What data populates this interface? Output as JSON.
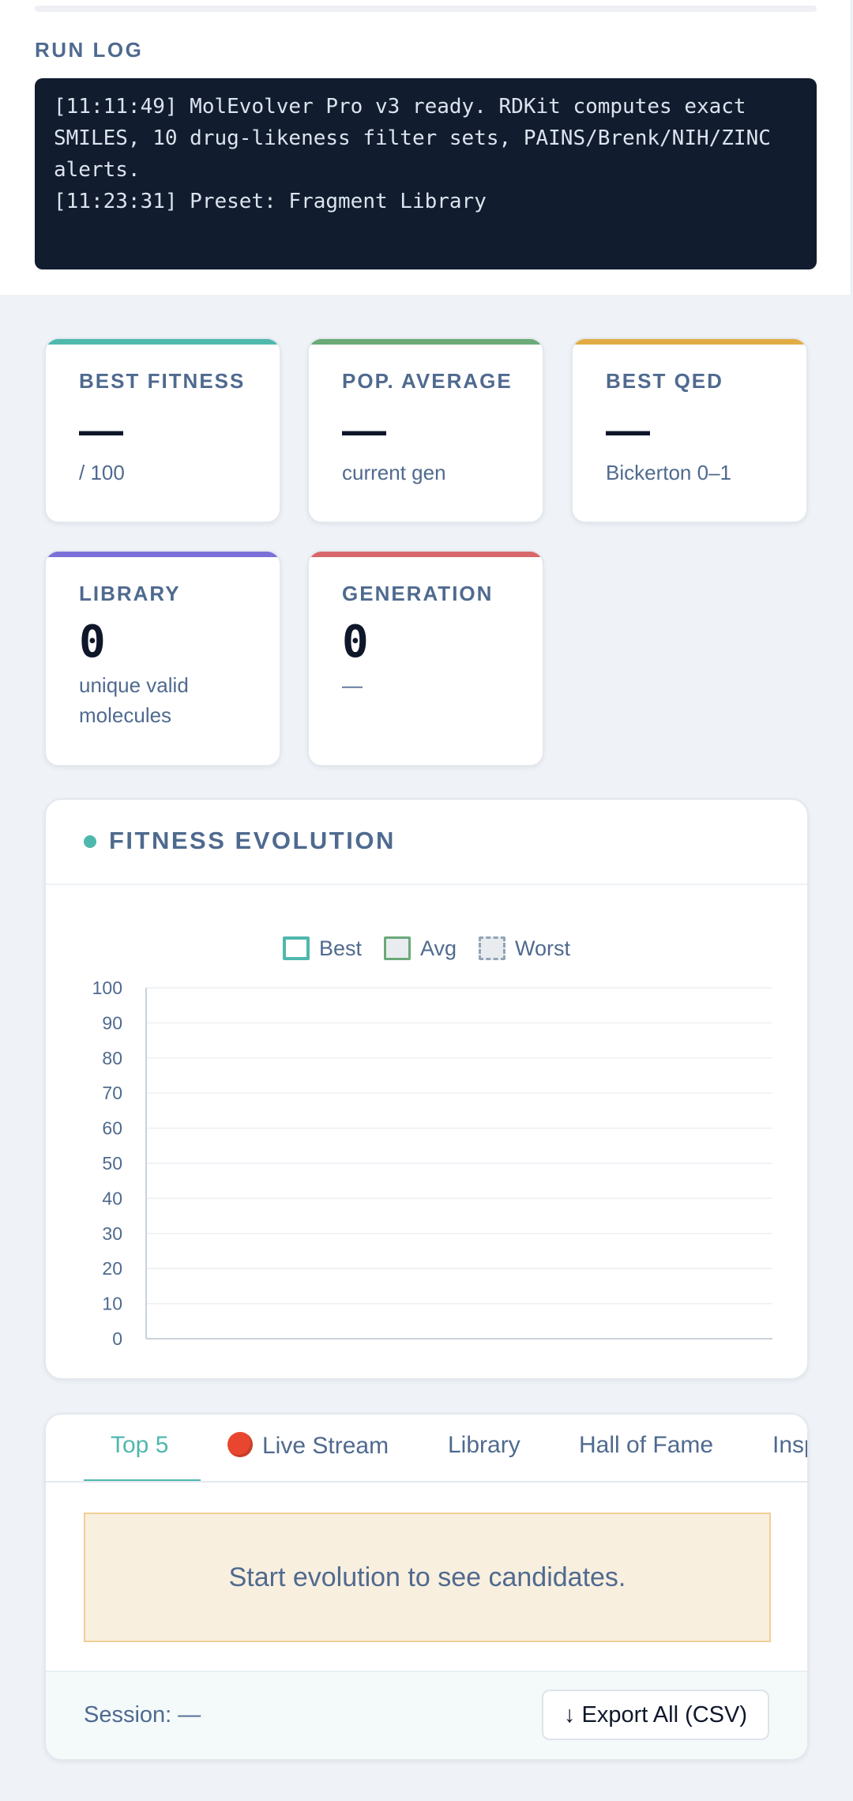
{
  "run_log": {
    "title": "RUN LOG",
    "lines": [
      "[11:11:49] MolEvolver Pro v3 ready. RDKit computes exact SMILES, 10 drug-likeness filter sets, PAINS/Brenk/NIH/ZINC alerts.",
      "[11:23:31] Preset: Fragment Library"
    ]
  },
  "stats": {
    "best_fitness": {
      "label": "BEST FITNESS",
      "value": "—",
      "sub": "/ 100",
      "accent": "#4fb8ad"
    },
    "pop_average": {
      "label": "POP. AVERAGE",
      "value": "—",
      "sub": "current gen",
      "accent": "#6aaa78"
    },
    "best_qed": {
      "label": "BEST QED",
      "value": "—",
      "sub": "Bickerton 0–1",
      "accent": "#e2ac45"
    },
    "library": {
      "label": "LIBRARY",
      "value": "0",
      "sub": "unique valid molecules",
      "accent": "#7b6fd8"
    },
    "generation": {
      "label": "GENERATION",
      "value": "0",
      "sub": "—",
      "accent": "#d8676b"
    }
  },
  "chart_section": {
    "title": "FITNESS EVOLUTION",
    "icon": "status-dot-icon"
  },
  "chart_data": {
    "type": "line",
    "title": "",
    "xlabel": "",
    "ylabel": "",
    "ylim": [
      0,
      100
    ],
    "yticks": [
      0,
      10,
      20,
      30,
      40,
      50,
      60,
      70,
      80,
      90,
      100
    ],
    "grid": true,
    "legend_position": "top-center",
    "series": [
      {
        "name": "Best",
        "values": [],
        "color": "#4fb8ad"
      },
      {
        "name": "Avg",
        "values": [],
        "color": "#6aaa78"
      },
      {
        "name": "Worst",
        "values": [],
        "color": "#94a3b8"
      }
    ]
  },
  "tabs": {
    "items": [
      "Top 5",
      "Live Stream",
      "Library",
      "Hall of Fame",
      "Insp"
    ],
    "active": "Top 5",
    "live_icon": "red-circle-icon"
  },
  "empty_message": "Start evolution to see candidates.",
  "footer": {
    "session": "Session: —",
    "export_label": "↓ Export All (CSV)"
  }
}
